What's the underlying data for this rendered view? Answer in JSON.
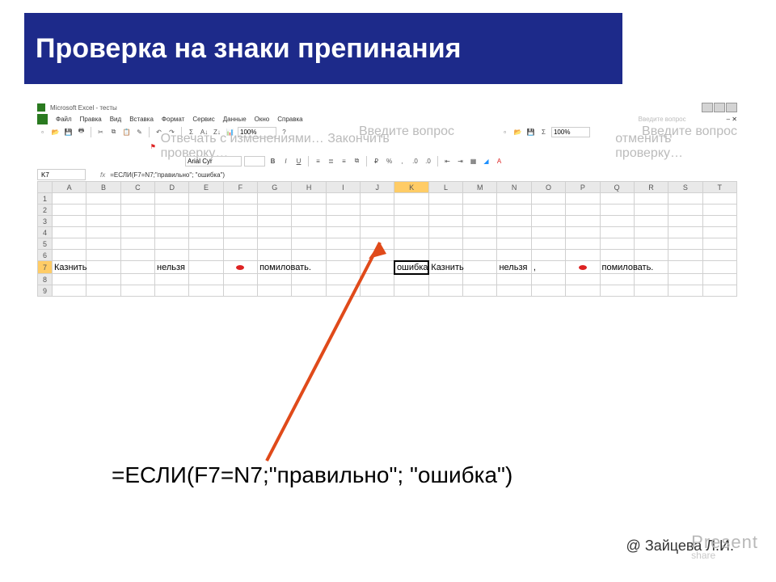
{
  "title": "Проверка на знаки препинания",
  "excel": {
    "app_title": "Microsoft Excel - тесты",
    "menu": [
      "Файл",
      "Правка",
      "Вид",
      "Вставка",
      "Формат",
      "Сервис",
      "Данные",
      "Окно",
      "Справка"
    ],
    "ask_prompt": "Введите вопрос",
    "review_hint_1": "Отвечать с изменениями…  Закончить проверку…",
    "review_hint_2": "отменить проверку…",
    "font_name": "Arial Cyr",
    "zoom": "100%",
    "name_box": "K7",
    "formula": "=ЕСЛИ(F7=N7;\"правильно\"; \"ошибка\")",
    "columns": [
      "A",
      "B",
      "C",
      "D",
      "E",
      "F",
      "G",
      "H",
      "I",
      "J",
      "K",
      "L",
      "M",
      "N",
      "O",
      "P",
      "Q",
      "R",
      "S",
      "T"
    ],
    "rows": [
      "1",
      "2",
      "3",
      "4",
      "5",
      "6",
      "7",
      "8",
      "9"
    ],
    "row7": {
      "A": "Казнить",
      "D": "нельзя",
      "G": "помиловать.",
      "K": "ошибка",
      "L": "Казнить",
      "N": "нельзя",
      "O": ",",
      "Q": "помиловать."
    },
    "error_dot_cols": [
      "F",
      "P"
    ]
  },
  "big_formula": "=ЕСЛИ(F7=N7;\"правильно\"; \"ошибка\")",
  "credit": "@ Зайцева Л.И.",
  "watermark_main": "Present",
  "watermark_sub": "share"
}
